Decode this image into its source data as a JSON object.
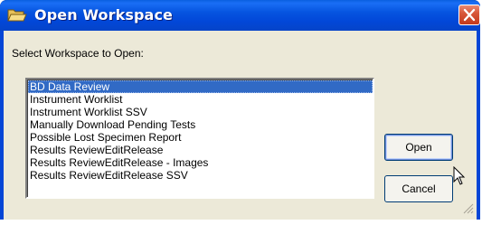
{
  "window": {
    "title": "Open Workspace",
    "title_icon": "folder-open-icon",
    "close_icon": "close-icon"
  },
  "dialog": {
    "prompt": "Select Workspace to Open:",
    "workspaces": [
      {
        "label": "BD Data Review",
        "selected": true
      },
      {
        "label": "Instrument Worklist",
        "selected": false
      },
      {
        "label": "Instrument Worklist SSV",
        "selected": false
      },
      {
        "label": "Manually Download Pending Tests",
        "selected": false
      },
      {
        "label": "Possible Lost Specimen Report",
        "selected": false
      },
      {
        "label": "Results ReviewEditRelease",
        "selected": false
      },
      {
        "label": "Results ReviewEditRelease - Images",
        "selected": false
      },
      {
        "label": "Results ReviewEditRelease SSV",
        "selected": false
      }
    ],
    "open_label": "Open",
    "cancel_label": "Cancel"
  },
  "colors": {
    "titlebar": "#0654e0",
    "selection": "#316ac5",
    "dialog_bg": "#ece9d8",
    "close_button": "#d8583a"
  }
}
